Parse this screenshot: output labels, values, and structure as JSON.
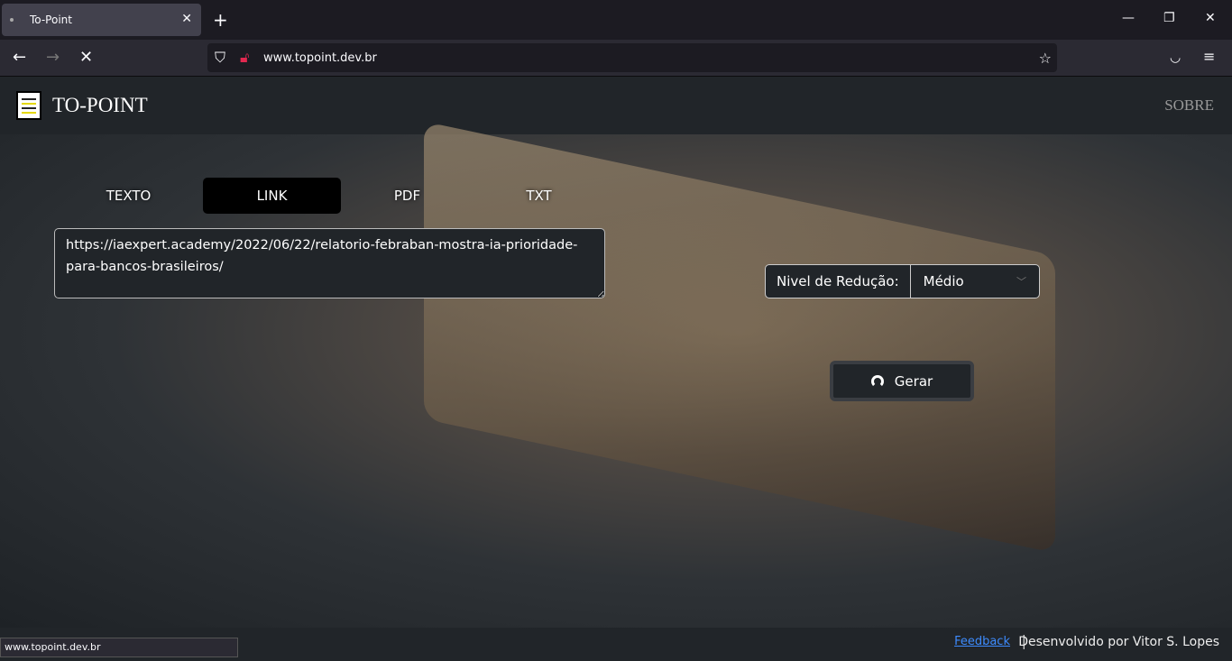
{
  "browser": {
    "tab_title": "To-Point",
    "url_host": "www.topoint.dev.br",
    "status_url": "www.topoint.dev.br"
  },
  "header": {
    "brand": "TO-POINT",
    "nav_sobre": "SOBRE"
  },
  "modes": [
    {
      "label": "TEXTO"
    },
    {
      "label": "LINK",
      "active": true
    },
    {
      "label": "PDF"
    },
    {
      "label": "TXT"
    }
  ],
  "input": {
    "value": "https://iaexpert.academy/2022/06/22/relatorio-febraban-mostra-ia-prioridade-para-bancos-brasileiros/"
  },
  "reduction": {
    "label": "Nivel de Redução:",
    "selected": "Médio"
  },
  "generate": {
    "label": "Gerar"
  },
  "footer": {
    "feedback": "Feedback",
    "separator": "|",
    "credit": "Desenvolvido por Vitor S. Lopes"
  }
}
